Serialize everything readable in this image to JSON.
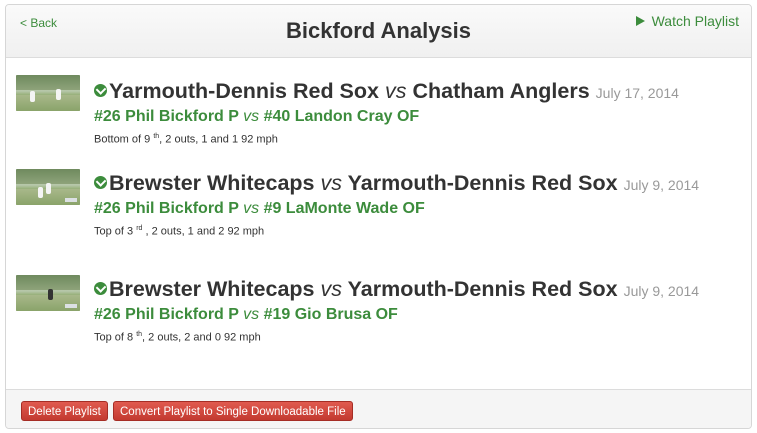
{
  "header": {
    "back_label": "< Back",
    "title": "Bickford Analysis",
    "watch_label": "Watch Playlist",
    "accent_color": "#3c8c3c"
  },
  "items": [
    {
      "team_home": "Yarmouth-Dennis Red Sox",
      "vs": "vs",
      "team_away": "Chatham Anglers",
      "date": "July 17, 2014",
      "pitcher": "#26 Phil Bickford P",
      "batter": "#40 Landon Cray OF",
      "half": "Bottom of 9",
      "suffix": "th",
      "situation": ", 2 outs, 1 and 1 92 mph"
    },
    {
      "team_home": "Brewster Whitecaps",
      "vs": "vs",
      "team_away": "Yarmouth-Dennis Red Sox",
      "date": "July 9, 2014",
      "pitcher": "#26 Phil Bickford P",
      "batter": "#9 LaMonte Wade OF",
      "half": "Top of 3",
      "suffix": "rd",
      "situation": " , 2 outs, 1 and 2 92 mph"
    },
    {
      "team_home": "Brewster Whitecaps",
      "vs": "vs",
      "team_away": "Yarmouth-Dennis Red Sox",
      "date": "July 9, 2014",
      "pitcher": "#26 Phil Bickford P",
      "batter": "#19 Gio Brusa OF",
      "half": "Top of 8",
      "suffix": "th",
      "situation": ", 2 outs, 2 and 0 92 mph"
    }
  ],
  "footer": {
    "delete_label": "Delete Playlist",
    "convert_label": "Convert Playlist to Single Downloadable File",
    "button_color": "#c33a30"
  },
  "icons": {
    "ball": "baseball-icon",
    "play": "play-icon"
  }
}
